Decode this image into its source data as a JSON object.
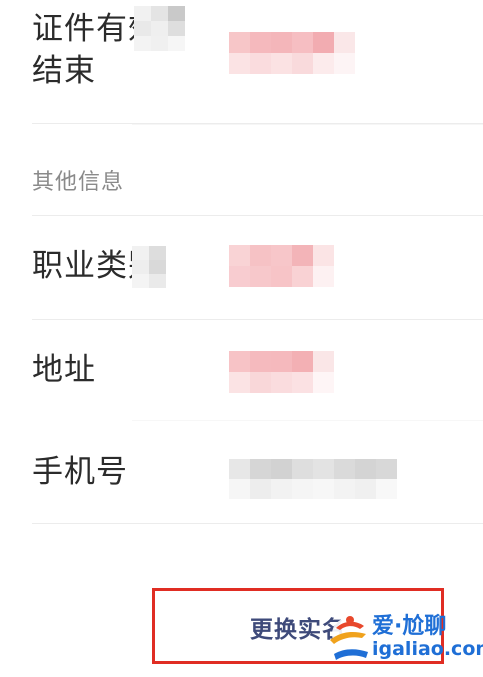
{
  "fields": {
    "cert_validity_line1": "证件有效",
    "cert_validity_line2": "结束",
    "section_other": "其他信息",
    "occupation": "职业类别",
    "address": "地址",
    "phone": "手机号"
  },
  "action": {
    "change_realname": "更换实名"
  },
  "watermark": {
    "title": "爱·尬聊",
    "url": "igaliao.com"
  },
  "colors": {
    "red_highlight": "#e02d23",
    "action_text": "#3e4a7a",
    "watermark_blue": "#1f6fd6"
  }
}
